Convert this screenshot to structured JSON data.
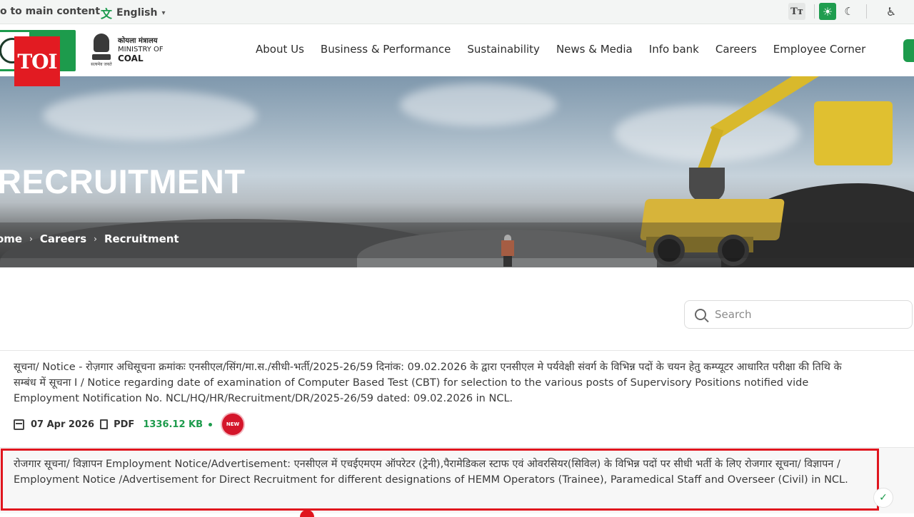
{
  "topbar": {
    "skip_link": "o to main content",
    "language": {
      "icon": "translate-icon",
      "label": "English",
      "caret": "▾"
    },
    "tools": {
      "text_size_label": "Tт",
      "light_icon": "sun-icon",
      "dark_icon": "moon-icon",
      "accessibility_icon": "accessibility-icon"
    }
  },
  "header": {
    "toi_watermark": "TOI",
    "ministry": {
      "hindi": "कोयला मंत्रालय",
      "line1": "MINISTRY OF",
      "line2": "COAL",
      "motto": "सत्यमेव जयते"
    },
    "menu": [
      "About Us",
      "Business & Performance",
      "Sustainability",
      "News & Media",
      "Info bank",
      "Careers",
      "Employee Corner"
    ]
  },
  "hero": {
    "title": "RECRUITMENT",
    "breadcrumb": [
      "ome",
      "Careers",
      "Recruitment"
    ],
    "breadcrumb_sep": "›"
  },
  "search": {
    "placeholder": "Search"
  },
  "notices": [
    {
      "title": "सूचना/ Notice - रोज़गार अधिसूचना क्रमांकः एनसीएल/सिंग/मा.स./सीधी-भर्ती/2025-26/59 दिनांक: 09.02.2026 के द्वारा एनसीएल मे पर्यवेक्षी संवर्ग के विभिन्न पदों के चयन हेतु कम्प्यूटर आधारित परीक्षा की तिथि के सम्बंध में सूचना I / Notice regarding date of examination of Computer Based Test (CBT) for selection to the various posts of Supervisory Positions notified vide Employment Notification No. NCL/HQ/HR/Recruitment/DR/2025-26/59 dated: 09.02.2026 in NCL.",
      "date": "07 Apr 2026",
      "file_type": "PDF",
      "file_size": "1336.12 KB",
      "badge": "NEW"
    },
    {
      "title": "रोजगार सूचना/ विज्ञापन Employment Notice/Advertisement: एनसीएल में एचईएमएम ऑपरेटर (ट्रेनी),पैरामेडिकल स्टाफ एवं ओवरसियर(सिविल) के विभिन्न पदों पर सीधी भर्ती के लिए रोजगार सूचना/ विज्ञापन / Employment Notice /Advertisement for Direct Recruitment for different designations of HEMM Operators (Trainee), Paramedical Staff and Overseer (Civil) in NCL."
    }
  ],
  "colors": {
    "brand_green": "#1d9b4c",
    "highlight_red": "#e0151e",
    "toi_red": "#e21b22"
  }
}
